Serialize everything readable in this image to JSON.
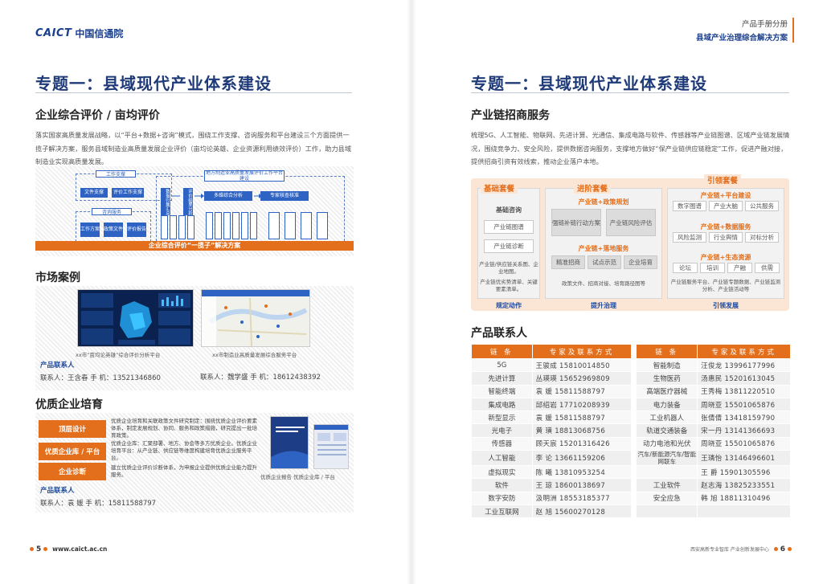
{
  "left": {
    "logo_en": "CAICT",
    "logo_cn": "中国信通院",
    "title": "专题一：县域现代产业体系建设",
    "sec1": {
      "heading": "企业综合评价 / 亩均评价",
      "text": "落实国家高质量发展战略，以“平台+数据+咨询”模式，围绕工作支撑、咨询服务和平台建设三个方面提供一揽子解决方案，服务县域制造业高质量发展企业评价（亩均论英雄、企业资源利用绩效评价）工作，助力县域制造业实现高质量发展。",
      "diagram": {
        "top_left": "工作支撑",
        "top_right": "地方制造业高质量发展评价工作平台建设",
        "btn1": "文件支撑",
        "btn2": "评价工作支撑",
        "mid_label": "咨询服务",
        "s1": "工作方案",
        "s2": "政策文件",
        "s3": "评价报告",
        "side1": "数据归集汇总",
        "side2": "评价结果分析",
        "btn3": "多维综合分析",
        "btn4": "专家核查核准",
        "bar": "企业综合评价“一揽子”解决方案"
      }
    },
    "sec2": {
      "heading": "市场案例",
      "cap1": "xx市“亩均论英雄”综合评价分析平台",
      "cap2": "xx市制造业高质量发展综合服务平台",
      "contact_title": "产品联系人",
      "contact1": "联系人：王含春    手   机：13521346860",
      "contact2": "联系人：魏学盛    手   机：18612438392"
    },
    "sec3": {
      "heading": "优质企业培育",
      "items": [
        {
          "label": "顶层设计",
          "text": "优质企业培育和关联政策文件研究制定：围绕优质企业评价要素体系，制定发展规划、协同、服务和政策措施，研究提出一批培育政策。"
        },
        {
          "label": "优质企业库 / 平台",
          "text": "优质企业库：汇聚部署、地方、协会等多方优质企业。优质企业培育平台：从产业链、供应链等维度构建培育优质企业服务平台。"
        },
        {
          "label": "企业诊断",
          "text": "建立优质企业评价诊断体系，为申报企业提供优质企业能力提升服务。"
        }
      ],
      "caption": "优质企业报告  优质企业库 / 平台",
      "contact_title": "产品联系人",
      "contact": "联系人：袁   媛    手   机：15811588797"
    },
    "footer_page": "5",
    "footer_url": "www.caict.ac.cn"
  },
  "right": {
    "header_line1": "产品手册分册",
    "header_line2": "县域产业治理综合解决方案",
    "title": "专题一：县域现代产业体系建设",
    "sec1": {
      "heading": "产业链招商服务",
      "text": "梳理5G、人工智能、物联网、先进计算、光通信、集成电路与软件、传感器等产业链图谱、区域产业链发展情况，围绕竞争力、安全风险，提供数据咨询服务，支撑地方做好“保产业链供应链稳定”工作，促进产融对接，提供招商引资有效线索，推动企业落户本地。",
      "diagram": {
        "basic": "基础套餐",
        "advanced": "进阶套餐",
        "guide": "引领套餐",
        "basic_consult": "基础咨询",
        "basic_items": [
          "产业链图谱",
          "产业链诊断"
        ],
        "basic_note1": "产业链/供应链关系图、企业地图。",
        "basic_note2": "产业链优劣势清单、关键要素清单。",
        "adv_g1": "产业链+政策规划",
        "adv_g1_items": [
          "强链补链行动方案",
          "产业链风险评估"
        ],
        "adv_g2": "产业链+落地服务",
        "adv_g2_items": [
          "精准招商",
          "试点示范",
          "企业培育"
        ],
        "adv_note": "政策文件、招商对接、培育路径图等",
        "guide_g1": "产业链+平台建设",
        "guide_g1_items": [
          "数字图谱",
          "产业大脑",
          "公共服务"
        ],
        "guide_g2": "产业链+数据服务",
        "guide_g2_items": [
          "风险监测",
          "行业舆情",
          "对标分析"
        ],
        "guide_g3": "产业链+生态资源",
        "guide_g3_items": [
          "论坛",
          "培训",
          "产融",
          "供需"
        ],
        "guide_note": "产业链服务平台、产业链专题数据、产业链监测分析、产业链活动等",
        "foot1": "规定动作",
        "foot2": "提升治理",
        "foot3": "引领发展"
      }
    },
    "sec2": {
      "heading": "产品联系人",
      "columns": [
        "链  条",
        "专家及联系方式",
        "链  条",
        "专家及联系方式"
      ],
      "rows": [
        [
          "5G",
          "王骏成 15810014850",
          "智能制造",
          "汪俊龙 13996177996"
        ],
        [
          "先进计算",
          "丛瑛瑛 15652969809",
          "生物医药",
          "汤惠民 15201613045"
        ],
        [
          "智能终端",
          "袁  媛 15811588797",
          "高端医疗器械",
          "王秀梅 13811220510"
        ],
        [
          "集成电路",
          "邱绍岩 17710208939",
          "电力装备",
          "周晓亚 15501065876"
        ],
        [
          "新型显示",
          "袁  媛 15811588797",
          "工业机器人",
          "张倩倩 13418159790"
        ],
        [
          "光电子",
          "黄  璜 18813068756",
          "轨道交通装备",
          "宋一丹 13141366693"
        ],
        [
          "传感器",
          "顾天宸 15201316426",
          "动力电池和光伏",
          "周晓亚 15501065876"
        ],
        [
          "人工智能",
          "李  论 13661159206",
          "汽车/新能源汽车/智能网联车",
          "王璘怡 13146496601"
        ],
        [
          "虚拟现实",
          "陈  曦 13810953254",
          "",
          "王  爵 15901305596"
        ],
        [
          "软件",
          "王  琼 18600138697",
          "工业软件",
          "赵志海 13825233551"
        ],
        [
          "数字安防",
          "汲明洲 18553185377",
          "安全应急",
          "韩  旭 18811310496"
        ],
        [
          "工业互联网",
          "赵  旭 15600270128",
          "",
          ""
        ]
      ]
    },
    "footer_org": "西安高新专业智库  产业创新发展中心",
    "footer_page": "6"
  },
  "colors": {
    "accent": "#e36e1b",
    "brand": "#1e3a78",
    "blue": "#2e63c4"
  }
}
